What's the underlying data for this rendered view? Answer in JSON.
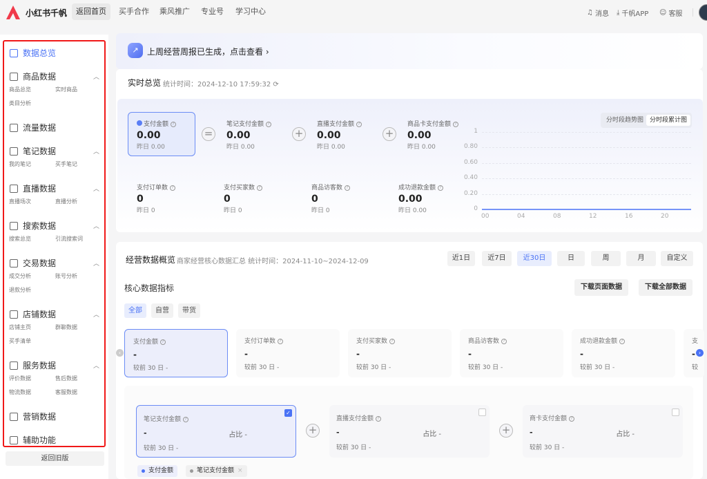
{
  "topbar": {
    "brand": "小红书千帆",
    "nav": [
      "返回首页",
      "买手合作",
      "乘风推广",
      "专业号",
      "学习中心"
    ],
    "right": [
      {
        "icon": "bell-icon",
        "label": "消息"
      },
      {
        "icon": "download-icon",
        "label": "千帆APP"
      },
      {
        "icon": "chat-icon",
        "label": "客服"
      }
    ]
  },
  "sidebar": {
    "groups": [
      {
        "label": "数据总览",
        "icon": "dashboard-icon",
        "active": true,
        "subs": []
      },
      {
        "label": "商品数据",
        "icon": "product-icon",
        "subs": [
          "商品总览",
          "实时商品",
          "类目分析"
        ]
      },
      {
        "label": "流量数据",
        "icon": "traffic-icon",
        "subs": []
      },
      {
        "label": "笔记数据",
        "icon": "book-icon",
        "subs": [
          "我的笔记",
          "买手笔记"
        ]
      },
      {
        "label": "直播数据",
        "icon": "live-icon",
        "subs": [
          "直播场次",
          "直播分析"
        ]
      },
      {
        "label": "搜索数据",
        "icon": "search-icon",
        "subs": [
          "搜索总览",
          "引流搜索词"
        ]
      },
      {
        "label": "交易数据",
        "icon": "trade-icon",
        "subs": [
          "成交分析",
          "账号分析",
          "退款分析"
        ]
      },
      {
        "label": "店铺数据",
        "icon": "store-icon",
        "subs": [
          "店铺主页",
          "群聊数据",
          "买手清单"
        ]
      },
      {
        "label": "服务数据",
        "icon": "service-icon",
        "subs": [
          "评价数据",
          "售后数据",
          "物流数据",
          "客服数据"
        ]
      },
      {
        "label": "营销数据",
        "icon": "megaphone-icon",
        "subs": []
      },
      {
        "label": "辅助功能",
        "icon": "tools-icon",
        "subs": []
      }
    ],
    "old_version": "返回旧版"
  },
  "banner": {
    "text": "上周经营周报已生成，点击查看 ›"
  },
  "realtime": {
    "title": "实时总览",
    "time": "统计时间：2024-12-10 17:59:32",
    "top_metrics": [
      {
        "label": "支付金额",
        "value": "0.00",
        "yesterday": "昨日 0.00"
      },
      {
        "label": "笔记支付金额",
        "value": "0.00",
        "yesterday": "昨日 0.00"
      },
      {
        "label": "直播支付金额",
        "value": "0.00",
        "yesterday": "昨日 0.00"
      },
      {
        "label": "商品卡支付金额",
        "value": "0.00",
        "yesterday": "昨日 0.00"
      }
    ],
    "bottom_metrics": [
      {
        "label": "支付订单数",
        "value": "0",
        "yesterday": "昨日 0"
      },
      {
        "label": "支付买家数",
        "value": "0",
        "yesterday": "昨日 0"
      },
      {
        "label": "商品访客数",
        "value": "0",
        "yesterday": "昨日 0"
      },
      {
        "label": "成功退款金额",
        "value": "0.00",
        "yesterday": "昨日 0.00"
      }
    ],
    "chart_toggle": [
      "分时段趋势图",
      "分时段累计图"
    ],
    "chart_toggle_active": 1
  },
  "chart_data": {
    "type": "line",
    "x": [
      0,
      1,
      2,
      3,
      4,
      5,
      6,
      7,
      8,
      9,
      10,
      11,
      12,
      13,
      14,
      15,
      16,
      17,
      18,
      19,
      20,
      21,
      22,
      23
    ],
    "x_tick_labels": [
      "00",
      "04",
      "08",
      "12",
      "16",
      "20"
    ],
    "y_tick_labels": [
      "0",
      "0.20",
      "0.40",
      "0.60",
      "0.80",
      "1"
    ],
    "ylim": [
      0,
      1
    ],
    "grid": true,
    "series": [
      {
        "values": [
          0,
          0,
          0,
          0,
          0,
          0,
          0,
          0,
          0,
          0,
          0,
          0,
          0,
          0,
          0,
          0,
          0,
          0,
          0,
          0,
          0,
          0,
          0,
          0
        ],
        "color": "#4a72f5"
      }
    ]
  },
  "overview": {
    "title": "经营数据概览",
    "subtitle": "商家经营核心数据汇总",
    "time": "统计时间：2024-11-10~2024-12-09",
    "periods": [
      "近1日",
      "近7日",
      "近30日",
      "日",
      "周",
      "月",
      "自定义"
    ],
    "period_active": 2,
    "core_title": "核心数据指标",
    "download_page": "下载页面数据",
    "download_all": "下载全部数据",
    "tabs": [
      "全部",
      "自营",
      "带货"
    ],
    "kpis": [
      {
        "label": "支付金额",
        "value": "-",
        "compare": "较前 30 日 -"
      },
      {
        "label": "支付订单数",
        "value": "-",
        "compare": "较前 30 日 -"
      },
      {
        "label": "支付买家数",
        "value": "-",
        "compare": "较前 30 日 -"
      },
      {
        "label": "商品访客数",
        "value": "-",
        "compare": "较前 30 日 -"
      },
      {
        "label": "成功退款金额",
        "value": "-",
        "compare": "较前 30 日 -"
      },
      {
        "label": "支",
        "value": "-",
        "compare": "较"
      }
    ],
    "breakdown": [
      {
        "label": "笔记支付金额",
        "value": "-",
        "ratio": "占比 -",
        "compare": "较前 30 日 -",
        "checked": true
      },
      {
        "label": "直播支付金额",
        "value": "-",
        "ratio": "占比 -",
        "compare": "较前 30 日 -",
        "checked": false
      },
      {
        "label": "商卡支付金额",
        "value": "-",
        "ratio": "占比 -",
        "compare": "较前 30 日 -",
        "checked": false
      }
    ],
    "legend": [
      "支付金额",
      "笔记支付金额"
    ],
    "colors": {
      "accent": "#4a72f5",
      "highlight_border": "#f01818"
    }
  }
}
